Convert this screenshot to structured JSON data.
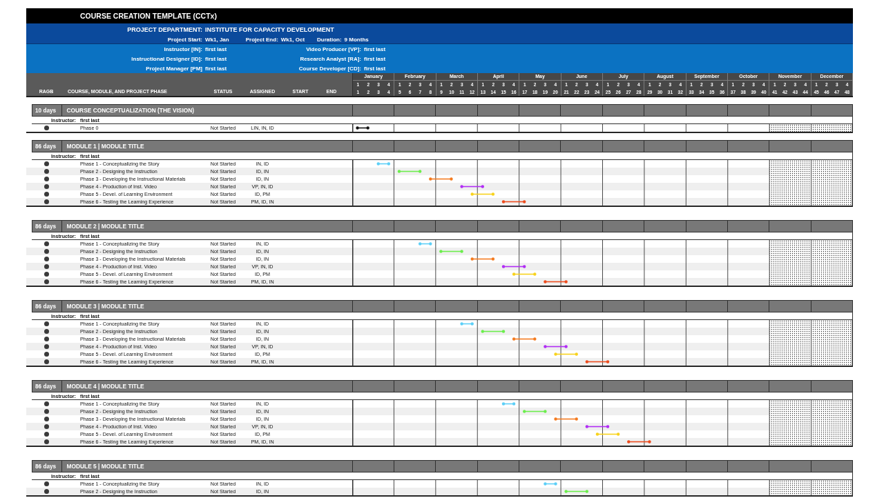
{
  "title": "COURSE CREATION TEMPLATE (CCTx)",
  "project": {
    "label": "PROJECT DEPARTMENT:",
    "department": "INSTITUTE FOR CAPACITY DEVELOPMENT",
    "details": [
      {
        "label": "Project Start:",
        "value": "Wk1, Jan"
      },
      {
        "label": "Project End:",
        "value": "Wk1, Oct"
      },
      {
        "label": "Duration:",
        "value": "9 Months"
      }
    ]
  },
  "team": [
    {
      "label": "Instructor [IN]:",
      "value": "first last"
    },
    {
      "label": "Video Producer [VP]:",
      "value": "first last"
    },
    {
      "label": "Instructional Designer [ID]:",
      "value": "first last"
    },
    {
      "label": "Research Analyst [RA]:",
      "value": "first last"
    },
    {
      "label": "Project Manager [PM]",
      "value": "first last"
    },
    {
      "label": "Course Developer [CD]:",
      "value": "first last"
    }
  ],
  "columns": [
    "RAGB",
    "COURSE, MODULE, AND PROJECT PHASE",
    "STATUS",
    "ASSIGNED",
    "START",
    "END"
  ],
  "timeline": {
    "months": [
      {
        "name": "January",
        "weeks": [
          "1",
          "2",
          "3",
          "4"
        ],
        "week_numbers": [
          "1",
          "2",
          "3",
          "4"
        ],
        "shaded": false
      },
      {
        "name": "February",
        "weeks": [
          "1",
          "2",
          "3",
          "4"
        ],
        "week_numbers": [
          "5",
          "6",
          "7",
          "8"
        ],
        "shaded": false
      },
      {
        "name": "March",
        "weeks": [
          "1",
          "2",
          "3",
          "4"
        ],
        "week_numbers": [
          "9",
          "10",
          "11",
          "12"
        ],
        "shaded": false
      },
      {
        "name": "April",
        "weeks": [
          "1",
          "2",
          "3",
          "4"
        ],
        "week_numbers": [
          "13",
          "14",
          "15",
          "16"
        ],
        "shaded": false
      },
      {
        "name": "May",
        "weeks": [
          "1",
          "2",
          "3",
          "4"
        ],
        "week_numbers": [
          "17",
          "18",
          "19",
          "20"
        ],
        "shaded": false
      },
      {
        "name": "June",
        "weeks": [
          "1",
          "2",
          "3",
          "4"
        ],
        "week_numbers": [
          "21",
          "22",
          "23",
          "24"
        ],
        "shaded": false
      },
      {
        "name": "July",
        "weeks": [
          "1",
          "2",
          "3",
          "4"
        ],
        "week_numbers": [
          "25",
          "26",
          "27",
          "28"
        ],
        "shaded": false
      },
      {
        "name": "August",
        "weeks": [
          "1",
          "2",
          "3",
          "4"
        ],
        "week_numbers": [
          "29",
          "30",
          "31",
          "32"
        ],
        "shaded": false
      },
      {
        "name": "September",
        "weeks": [
          "1",
          "2",
          "3",
          "4"
        ],
        "week_numbers": [
          "33",
          "34",
          "35",
          "36"
        ],
        "shaded": false
      },
      {
        "name": "October",
        "weeks": [
          "1",
          "2",
          "3",
          "4"
        ],
        "week_numbers": [
          "37",
          "38",
          "39",
          "40"
        ],
        "shaded": false
      },
      {
        "name": "November",
        "weeks": [
          "1",
          "2",
          "3",
          "4"
        ],
        "week_numbers": [
          "41",
          "42",
          "43",
          "44"
        ],
        "shaded": true
      },
      {
        "name": "December",
        "weeks": [
          "1",
          "2",
          "3",
          "4"
        ],
        "week_numbers": [
          "45",
          "46",
          "47",
          "48"
        ],
        "shaded": true
      }
    ]
  },
  "sections": [
    {
      "duration": "10 days",
      "title": "COURSE CONCEPTUALIZATION (THE VISION)",
      "instructor_label": "Instructor:",
      "instructor": "first last",
      "phases": [
        {
          "name": "Phase 0",
          "status": "Not Started",
          "assigned": "LIN, IN, ID",
          "color": "#111111"
        }
      ]
    },
    {
      "duration": "86 days",
      "title": "MODULE 1 | MODULE TITLE",
      "instructor_label": "Instructor:",
      "instructor": "first last",
      "phases": [
        {
          "name": "Phase 1 - Conceptualizing the Story",
          "status": "Not Started",
          "assigned": "IN, ID",
          "color": "#5ccff7"
        },
        {
          "name": "Phase 2 - Designing the Instruction",
          "status": "Not Started",
          "assigned": "ID, IN",
          "color": "#6bee4c"
        },
        {
          "name": "Phase 3 - Developing the Instructional Materials",
          "status": "Not Started",
          "assigned": "ID, IN",
          "color": "#f47a1e"
        },
        {
          "name": "Phase 4 - Production of Inst. Video",
          "status": "Not Started",
          "assigned": "VP, IN, ID",
          "color": "#b12cf5"
        },
        {
          "name": "Phase 5 - Devel. of Learning Environment",
          "status": "Not Started",
          "assigned": "ID, PM",
          "color": "#f8d21c"
        },
        {
          "name": "Phase 6 - Testing the Learning Experience",
          "status": "Not Started",
          "assigned": "PM, ID, IN",
          "color": "#ec4b1d"
        }
      ]
    },
    {
      "duration": "86 days",
      "title": "MODULE 2 | MODULE TITLE",
      "instructor_label": "Instructor:",
      "instructor": "first last",
      "phases": [
        {
          "name": "Phase 1 - Conceptualizing the Story",
          "status": "Not Started",
          "assigned": "IN, ID",
          "color": "#5ccff7"
        },
        {
          "name": "Phase 2 - Designing the Instruction",
          "status": "Not Started",
          "assigned": "ID, IN",
          "color": "#6bee4c"
        },
        {
          "name": "Phase 3 - Developing the Instructional Materials",
          "status": "Not Started",
          "assigned": "ID, IN",
          "color": "#f47a1e"
        },
        {
          "name": "Phase 4 - Production of Inst. Video",
          "status": "Not Started",
          "assigned": "VP, IN, ID",
          "color": "#b12cf5"
        },
        {
          "name": "Phase 5 - Devel. of Learning Environment",
          "status": "Not Started",
          "assigned": "ID, PM",
          "color": "#f8d21c"
        },
        {
          "name": "Phase 6 - Testing the Learning Experience",
          "status": "Not Started",
          "assigned": "PM, ID, IN",
          "color": "#ec4b1d"
        }
      ]
    },
    {
      "duration": "86 days",
      "title": "MODULE 3 | MODULE TITLE",
      "instructor_label": "Instructor:",
      "instructor": "first last",
      "phases": [
        {
          "name": "Phase 1 - Conceptualizing the Story",
          "status": "Not Started",
          "assigned": "IN, ID",
          "color": "#5ccff7"
        },
        {
          "name": "Phase 2 - Designing the Instruction",
          "status": "Not Started",
          "assigned": "ID, IN",
          "color": "#6bee4c"
        },
        {
          "name": "Phase 3 - Developing the Instructional Materials",
          "status": "Not Started",
          "assigned": "ID, IN",
          "color": "#f47a1e"
        },
        {
          "name": "Phase 4 - Production of Inst. Video",
          "status": "Not Started",
          "assigned": "VP, IN, ID",
          "color": "#b12cf5"
        },
        {
          "name": "Phase 5 - Devel. of Learning Environment",
          "status": "Not Started",
          "assigned": "ID, PM",
          "color": "#f8d21c"
        },
        {
          "name": "Phase 6 - Testing the Learning Experience",
          "status": "Not Started",
          "assigned": "PM, ID, IN",
          "color": "#ec4b1d"
        }
      ]
    },
    {
      "duration": "86 days",
      "title": "MODULE 4 | MODULE TITLE",
      "instructor_label": "Instructor:",
      "instructor": "first last",
      "phases": [
        {
          "name": "Phase 1 - Conceptualizing the Story",
          "status": "Not Started",
          "assigned": "IN, ID",
          "color": "#5ccff7"
        },
        {
          "name": "Phase 2 - Designing the Instruction",
          "status": "Not Started",
          "assigned": "ID, IN",
          "color": "#6bee4c"
        },
        {
          "name": "Phase 3 - Developing the Instructional Materials",
          "status": "Not Started",
          "assigned": "ID, IN",
          "color": "#f47a1e"
        },
        {
          "name": "Phase 4 - Production of Inst. Video",
          "status": "Not Started",
          "assigned": "VP, IN, ID",
          "color": "#b12cf5"
        },
        {
          "name": "Phase 5 - Devel. of Learning Environment",
          "status": "Not Started",
          "assigned": "ID, PM",
          "color": "#f8d21c"
        },
        {
          "name": "Phase 6 - Testing the Learning Experience",
          "status": "Not Started",
          "assigned": "PM, ID, IN",
          "color": "#ec4b1d"
        }
      ]
    },
    {
      "duration": "86 days",
      "title": "MODULE 5 | MODULE TITLE",
      "instructor_label": "Instructor:",
      "instructor": "first last",
      "phases": [
        {
          "name": "Phase 1 - Conceptualizing the Story",
          "status": "Not Started",
          "assigned": "IN, ID",
          "color": "#5ccff7"
        },
        {
          "name": "Phase 2 - Designing the Instruction",
          "status": "Not Started",
          "assigned": "ID, IN",
          "color": "#6bee4c"
        }
      ]
    }
  ]
}
